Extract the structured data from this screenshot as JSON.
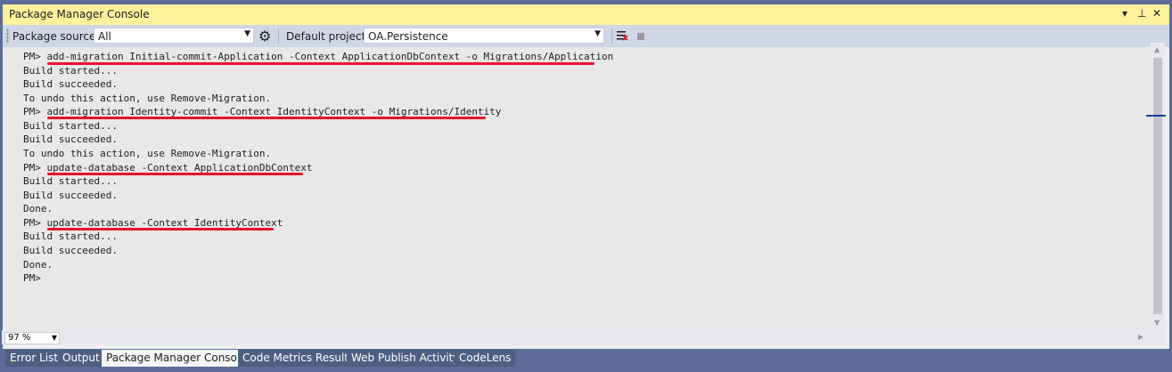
{
  "window": {
    "title": "Package Manager Console",
    "controls": {
      "dropdown": "▾",
      "pin": "⊥",
      "close": "✕"
    }
  },
  "toolbar": {
    "package_source_label": "Package source:",
    "package_source_value": "All",
    "default_project_label": "Default project:",
    "default_project_value": "OA.Persistence"
  },
  "console": {
    "lines": [
      "PM> add-migration Initial-commit-Application -Context ApplicationDbContext -o Migrations/Application",
      "Build started...",
      "Build succeeded.",
      "To undo this action, use Remove-Migration.",
      "PM> add-migration Identity-commit -Context IdentityContext -o Migrations/Identity",
      "Build started...",
      "Build succeeded.",
      "To undo this action, use Remove-Migration.",
      "PM> update-database -Context ApplicationDbContext",
      "Build started...",
      "Build succeeded.",
      "Done.",
      "PM> update-database -Context IdentityContext",
      "Build started...",
      "Build succeeded.",
      "Done.",
      "PM>"
    ]
  },
  "zoom": {
    "value": "97 %"
  },
  "tabs": [
    {
      "label": "Error List"
    },
    {
      "label": "Output"
    },
    {
      "label": "Package Manager Console",
      "active": true
    },
    {
      "label": "Code Metrics Results"
    },
    {
      "label": "Web Publish Activity"
    },
    {
      "label": "CodeLens"
    }
  ],
  "colors": {
    "title_bar": "#fff29d",
    "annotation_underline": "#e8112d",
    "tab_background": "#4d6082"
  }
}
